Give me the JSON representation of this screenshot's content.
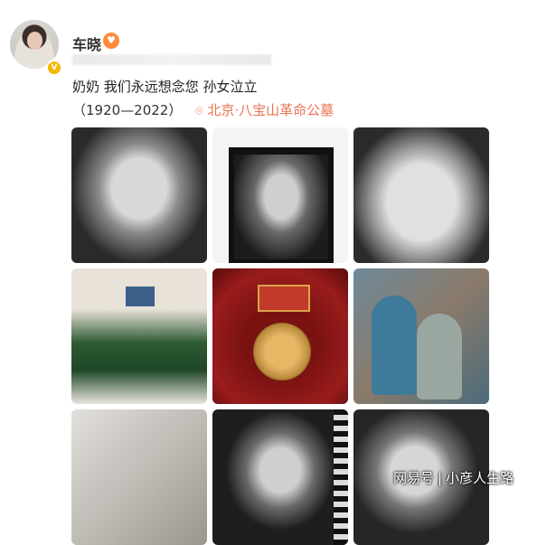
{
  "post": {
    "username": "车晓",
    "badge_icon": "heart-face-badge-icon",
    "verified_icon": "verified-v-icon",
    "text": "奶奶 我们永远想念您 孙女泣立",
    "years": "（1920—2022）",
    "location_icon": "location-pin-icon",
    "location": "北京·八宝山革命公墓",
    "location_color": "#eb7350"
  },
  "photos": [
    {
      "name": "photo-1"
    },
    {
      "name": "photo-2"
    },
    {
      "name": "photo-3"
    },
    {
      "name": "photo-4"
    },
    {
      "name": "photo-5"
    },
    {
      "name": "photo-6"
    },
    {
      "name": "photo-7"
    },
    {
      "name": "photo-8"
    },
    {
      "name": "photo-9"
    }
  ],
  "watermark": {
    "brand": "网易号",
    "separator": "|",
    "account": "小彦人生路"
  }
}
